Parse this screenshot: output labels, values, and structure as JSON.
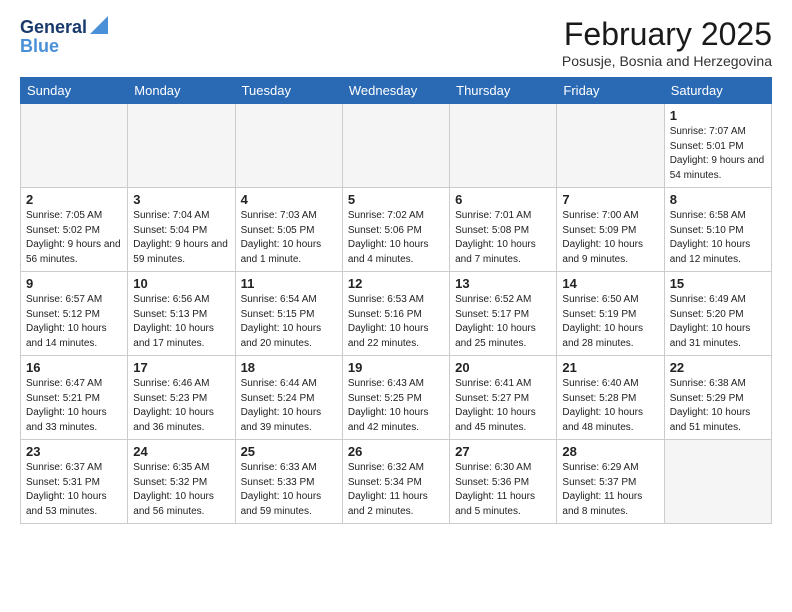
{
  "header": {
    "logo_line1": "General",
    "logo_line2": "Blue",
    "month": "February 2025",
    "location": "Posusje, Bosnia and Herzegovina"
  },
  "weekdays": [
    "Sunday",
    "Monday",
    "Tuesday",
    "Wednesday",
    "Thursday",
    "Friday",
    "Saturday"
  ],
  "weeks": [
    [
      {
        "day": "",
        "info": ""
      },
      {
        "day": "",
        "info": ""
      },
      {
        "day": "",
        "info": ""
      },
      {
        "day": "",
        "info": ""
      },
      {
        "day": "",
        "info": ""
      },
      {
        "day": "",
        "info": ""
      },
      {
        "day": "1",
        "info": "Sunrise: 7:07 AM\nSunset: 5:01 PM\nDaylight: 9 hours and 54 minutes."
      }
    ],
    [
      {
        "day": "2",
        "info": "Sunrise: 7:05 AM\nSunset: 5:02 PM\nDaylight: 9 hours and 56 minutes."
      },
      {
        "day": "3",
        "info": "Sunrise: 7:04 AM\nSunset: 5:04 PM\nDaylight: 9 hours and 59 minutes."
      },
      {
        "day": "4",
        "info": "Sunrise: 7:03 AM\nSunset: 5:05 PM\nDaylight: 10 hours and 1 minute."
      },
      {
        "day": "5",
        "info": "Sunrise: 7:02 AM\nSunset: 5:06 PM\nDaylight: 10 hours and 4 minutes."
      },
      {
        "day": "6",
        "info": "Sunrise: 7:01 AM\nSunset: 5:08 PM\nDaylight: 10 hours and 7 minutes."
      },
      {
        "day": "7",
        "info": "Sunrise: 7:00 AM\nSunset: 5:09 PM\nDaylight: 10 hours and 9 minutes."
      },
      {
        "day": "8",
        "info": "Sunrise: 6:58 AM\nSunset: 5:10 PM\nDaylight: 10 hours and 12 minutes."
      }
    ],
    [
      {
        "day": "9",
        "info": "Sunrise: 6:57 AM\nSunset: 5:12 PM\nDaylight: 10 hours and 14 minutes."
      },
      {
        "day": "10",
        "info": "Sunrise: 6:56 AM\nSunset: 5:13 PM\nDaylight: 10 hours and 17 minutes."
      },
      {
        "day": "11",
        "info": "Sunrise: 6:54 AM\nSunset: 5:15 PM\nDaylight: 10 hours and 20 minutes."
      },
      {
        "day": "12",
        "info": "Sunrise: 6:53 AM\nSunset: 5:16 PM\nDaylight: 10 hours and 22 minutes."
      },
      {
        "day": "13",
        "info": "Sunrise: 6:52 AM\nSunset: 5:17 PM\nDaylight: 10 hours and 25 minutes."
      },
      {
        "day": "14",
        "info": "Sunrise: 6:50 AM\nSunset: 5:19 PM\nDaylight: 10 hours and 28 minutes."
      },
      {
        "day": "15",
        "info": "Sunrise: 6:49 AM\nSunset: 5:20 PM\nDaylight: 10 hours and 31 minutes."
      }
    ],
    [
      {
        "day": "16",
        "info": "Sunrise: 6:47 AM\nSunset: 5:21 PM\nDaylight: 10 hours and 33 minutes."
      },
      {
        "day": "17",
        "info": "Sunrise: 6:46 AM\nSunset: 5:23 PM\nDaylight: 10 hours and 36 minutes."
      },
      {
        "day": "18",
        "info": "Sunrise: 6:44 AM\nSunset: 5:24 PM\nDaylight: 10 hours and 39 minutes."
      },
      {
        "day": "19",
        "info": "Sunrise: 6:43 AM\nSunset: 5:25 PM\nDaylight: 10 hours and 42 minutes."
      },
      {
        "day": "20",
        "info": "Sunrise: 6:41 AM\nSunset: 5:27 PM\nDaylight: 10 hours and 45 minutes."
      },
      {
        "day": "21",
        "info": "Sunrise: 6:40 AM\nSunset: 5:28 PM\nDaylight: 10 hours and 48 minutes."
      },
      {
        "day": "22",
        "info": "Sunrise: 6:38 AM\nSunset: 5:29 PM\nDaylight: 10 hours and 51 minutes."
      }
    ],
    [
      {
        "day": "23",
        "info": "Sunrise: 6:37 AM\nSunset: 5:31 PM\nDaylight: 10 hours and 53 minutes."
      },
      {
        "day": "24",
        "info": "Sunrise: 6:35 AM\nSunset: 5:32 PM\nDaylight: 10 hours and 56 minutes."
      },
      {
        "day": "25",
        "info": "Sunrise: 6:33 AM\nSunset: 5:33 PM\nDaylight: 10 hours and 59 minutes."
      },
      {
        "day": "26",
        "info": "Sunrise: 6:32 AM\nSunset: 5:34 PM\nDaylight: 11 hours and 2 minutes."
      },
      {
        "day": "27",
        "info": "Sunrise: 6:30 AM\nSunset: 5:36 PM\nDaylight: 11 hours and 5 minutes."
      },
      {
        "day": "28",
        "info": "Sunrise: 6:29 AM\nSunset: 5:37 PM\nDaylight: 11 hours and 8 minutes."
      },
      {
        "day": "",
        "info": ""
      }
    ]
  ]
}
